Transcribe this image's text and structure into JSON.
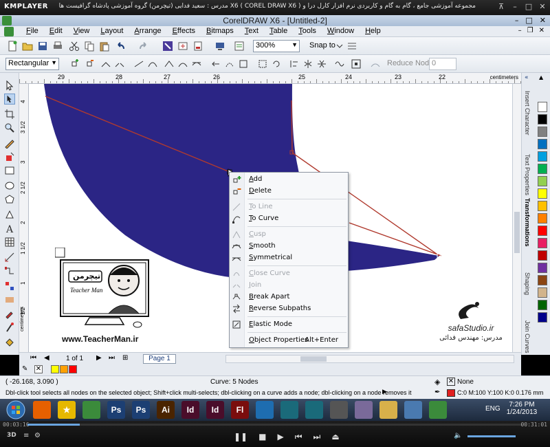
{
  "player": {
    "logo": "KMPLAYER",
    "caption": "مجموعه آموزشی جامع ، گام به گام و کاربردی نرم افزار کارل درا و X6 ( COREL DRAW X6 )  مدرس : سعید فدایی (تیچرمن) گروه آموزشی پادشاه گرافیست ها",
    "time_current": "00:03:16",
    "time_total": "00:31:01",
    "progress_fraction": 0.105
  },
  "window": {
    "title": "CorelDRAW X6 - [Untitled-2]"
  },
  "menu": {
    "items": [
      "File",
      "Edit",
      "View",
      "Layout",
      "Arrange",
      "Effects",
      "Bitmaps",
      "Text",
      "Table",
      "Tools",
      "Window",
      "Help"
    ]
  },
  "toolbar": {
    "zoom": "300%",
    "snap_to": "Snap to"
  },
  "property_bar": {
    "shape_mode": "Rectangular",
    "reduce_nodes_label": "Reduce Nodes",
    "reduce_nodes_value": "0"
  },
  "ruler": {
    "h_labels": [
      "29",
      "28",
      "27",
      "26",
      "25",
      "24",
      "23",
      "22"
    ],
    "units": "centimeters",
    "v_labels": [
      "4",
      "3 1/2",
      "3",
      "2 1/2",
      "2",
      "1 1/2",
      "1",
      "1/2"
    ]
  },
  "context_menu": {
    "items": [
      {
        "label": "Add",
        "enabled": true,
        "icon": "add-node-icon"
      },
      {
        "label": "Delete",
        "enabled": true,
        "icon": "delete-node-icon"
      },
      {
        "label": "To Line",
        "enabled": false,
        "icon": "to-line-icon"
      },
      {
        "label": "To Curve",
        "enabled": true,
        "icon": "to-curve-icon"
      },
      {
        "label": "Cusp",
        "enabled": false,
        "icon": "cusp-icon"
      },
      {
        "label": "Smooth",
        "enabled": true,
        "icon": "smooth-icon"
      },
      {
        "label": "Symmetrical",
        "enabled": true,
        "icon": "symmetrical-icon"
      },
      {
        "label": "Close Curve",
        "enabled": false,
        "icon": "close-curve-icon"
      },
      {
        "label": "Join",
        "enabled": false,
        "icon": "join-icon"
      },
      {
        "label": "Break Apart",
        "enabled": true,
        "icon": "break-apart-icon"
      },
      {
        "label": "Reverse Subpaths",
        "enabled": true,
        "icon": "reverse-subpaths-icon"
      },
      {
        "label": "Elastic Mode",
        "enabled": true,
        "icon": "elastic-mode-icon"
      },
      {
        "label": "Object Properties",
        "enabled": true,
        "icon": "",
        "shortcut": "Alt+Enter"
      }
    ]
  },
  "docker": {
    "tabs": [
      "Insert Character",
      "Text Properties",
      "Transformations",
      "Shaping",
      "Join Curves"
    ],
    "active_tab": "Transformations"
  },
  "palette": {
    "colors": [
      "#ffffff",
      "#000000",
      "#808080",
      "#0070c0",
      "#00a0e0",
      "#00b050",
      "#92d050",
      "#ffff00",
      "#ffc000",
      "#ff8000",
      "#ff0000",
      "#e91e63",
      "#c00000",
      "#7030a0",
      "#8b4513",
      "#d2b48c",
      "#006400",
      "#00008b"
    ]
  },
  "page_nav": {
    "count": "1 of 1",
    "page_tab": "Page 1"
  },
  "doc_palette": {
    "colors": [
      "#ffff00",
      "#ffa000",
      "#ff0000"
    ]
  },
  "status": {
    "coords": "( -26.168, 3.090 )",
    "selection": "Curve: 5 Nodes",
    "hint": "Dbl-click tool selects all nodes on the selected object; Shift+click multi-selects; dbl-clicking on a curve adds a node; dbl-clicking on a node removes it",
    "fill": "None",
    "outline": "C:0 M:100 Y:100 K:0  0.176 mm",
    "outline_color": "#e02020"
  },
  "watermark": {
    "left_site": "www.TeacherMan.ir",
    "left_logo_fa": "تیچرمن",
    "left_logo_en": "Teacher Man",
    "right_site": "safaStudio.ir",
    "right_teacher": "مدرس: مهندس فدائی"
  },
  "taskbar": {
    "apps": [
      {
        "name": "firefox",
        "label": "",
        "color": "#e66000"
      },
      {
        "name": "star",
        "label": "★",
        "color": "#e6b800"
      },
      {
        "name": "coreldraw-green",
        "label": "",
        "color": "#3b8b3b"
      },
      {
        "name": "photoshop",
        "label": "Ps",
        "color": "#1c3f73"
      },
      {
        "name": "photoshop2",
        "label": "Ps",
        "color": "#1c3f73"
      },
      {
        "name": "illustrator",
        "label": "Ai",
        "color": "#4a2400"
      },
      {
        "name": "indesign",
        "label": "Id",
        "color": "#4a0d2a"
      },
      {
        "name": "indesign2",
        "label": "Id",
        "color": "#4a0d2a"
      },
      {
        "name": "flash",
        "label": "Fl",
        "color": "#7a0d0d"
      },
      {
        "name": "browser",
        "label": "",
        "color": "#1e6db0"
      },
      {
        "name": "media",
        "label": "",
        "color": "#1a6a7a"
      },
      {
        "name": "media2",
        "label": "",
        "color": "#1a6a7a"
      },
      {
        "name": "tool",
        "label": "",
        "color": "#555555"
      },
      {
        "name": "dvd",
        "label": "",
        "color": "#7a6a9a"
      },
      {
        "name": "folder",
        "label": "",
        "color": "#d8b04a"
      },
      {
        "name": "blank",
        "label": "",
        "color": "#4a7ab0"
      },
      {
        "name": "coreldraw-active",
        "label": "",
        "color": "#3b8b3b"
      }
    ],
    "lang": "ENG",
    "time": "7:26 PM",
    "date": "1/24/2013"
  }
}
